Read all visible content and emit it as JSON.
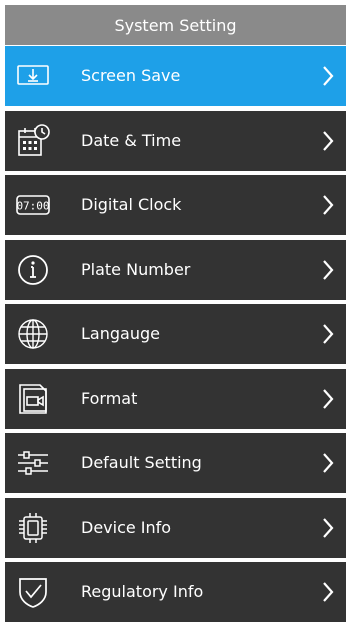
{
  "header": {
    "title": "System Setting"
  },
  "colors": {
    "active": "#1ea0e8",
    "row": "#333333",
    "header": "#8a8a8a",
    "text": "#ffffff"
  },
  "menu": {
    "items": [
      {
        "label": "Screen Save",
        "icon": "screen-save-icon",
        "active": true
      },
      {
        "label": "Date & Time",
        "icon": "calendar-clock-icon",
        "active": false
      },
      {
        "label": "Digital Clock",
        "icon": "digital-clock-icon",
        "active": false,
        "icon_text": "07:00"
      },
      {
        "label": "Plate Number",
        "icon": "info-icon",
        "active": false
      },
      {
        "label": "Langauge",
        "icon": "globe-icon",
        "active": false
      },
      {
        "label": "Format",
        "icon": "format-icon",
        "active": false
      },
      {
        "label": "Default Setting",
        "icon": "sliders-icon",
        "active": false
      },
      {
        "label": "Device Info",
        "icon": "chip-icon",
        "active": false
      },
      {
        "label": "Regulatory Info",
        "icon": "shield-check-icon",
        "active": false
      }
    ]
  }
}
